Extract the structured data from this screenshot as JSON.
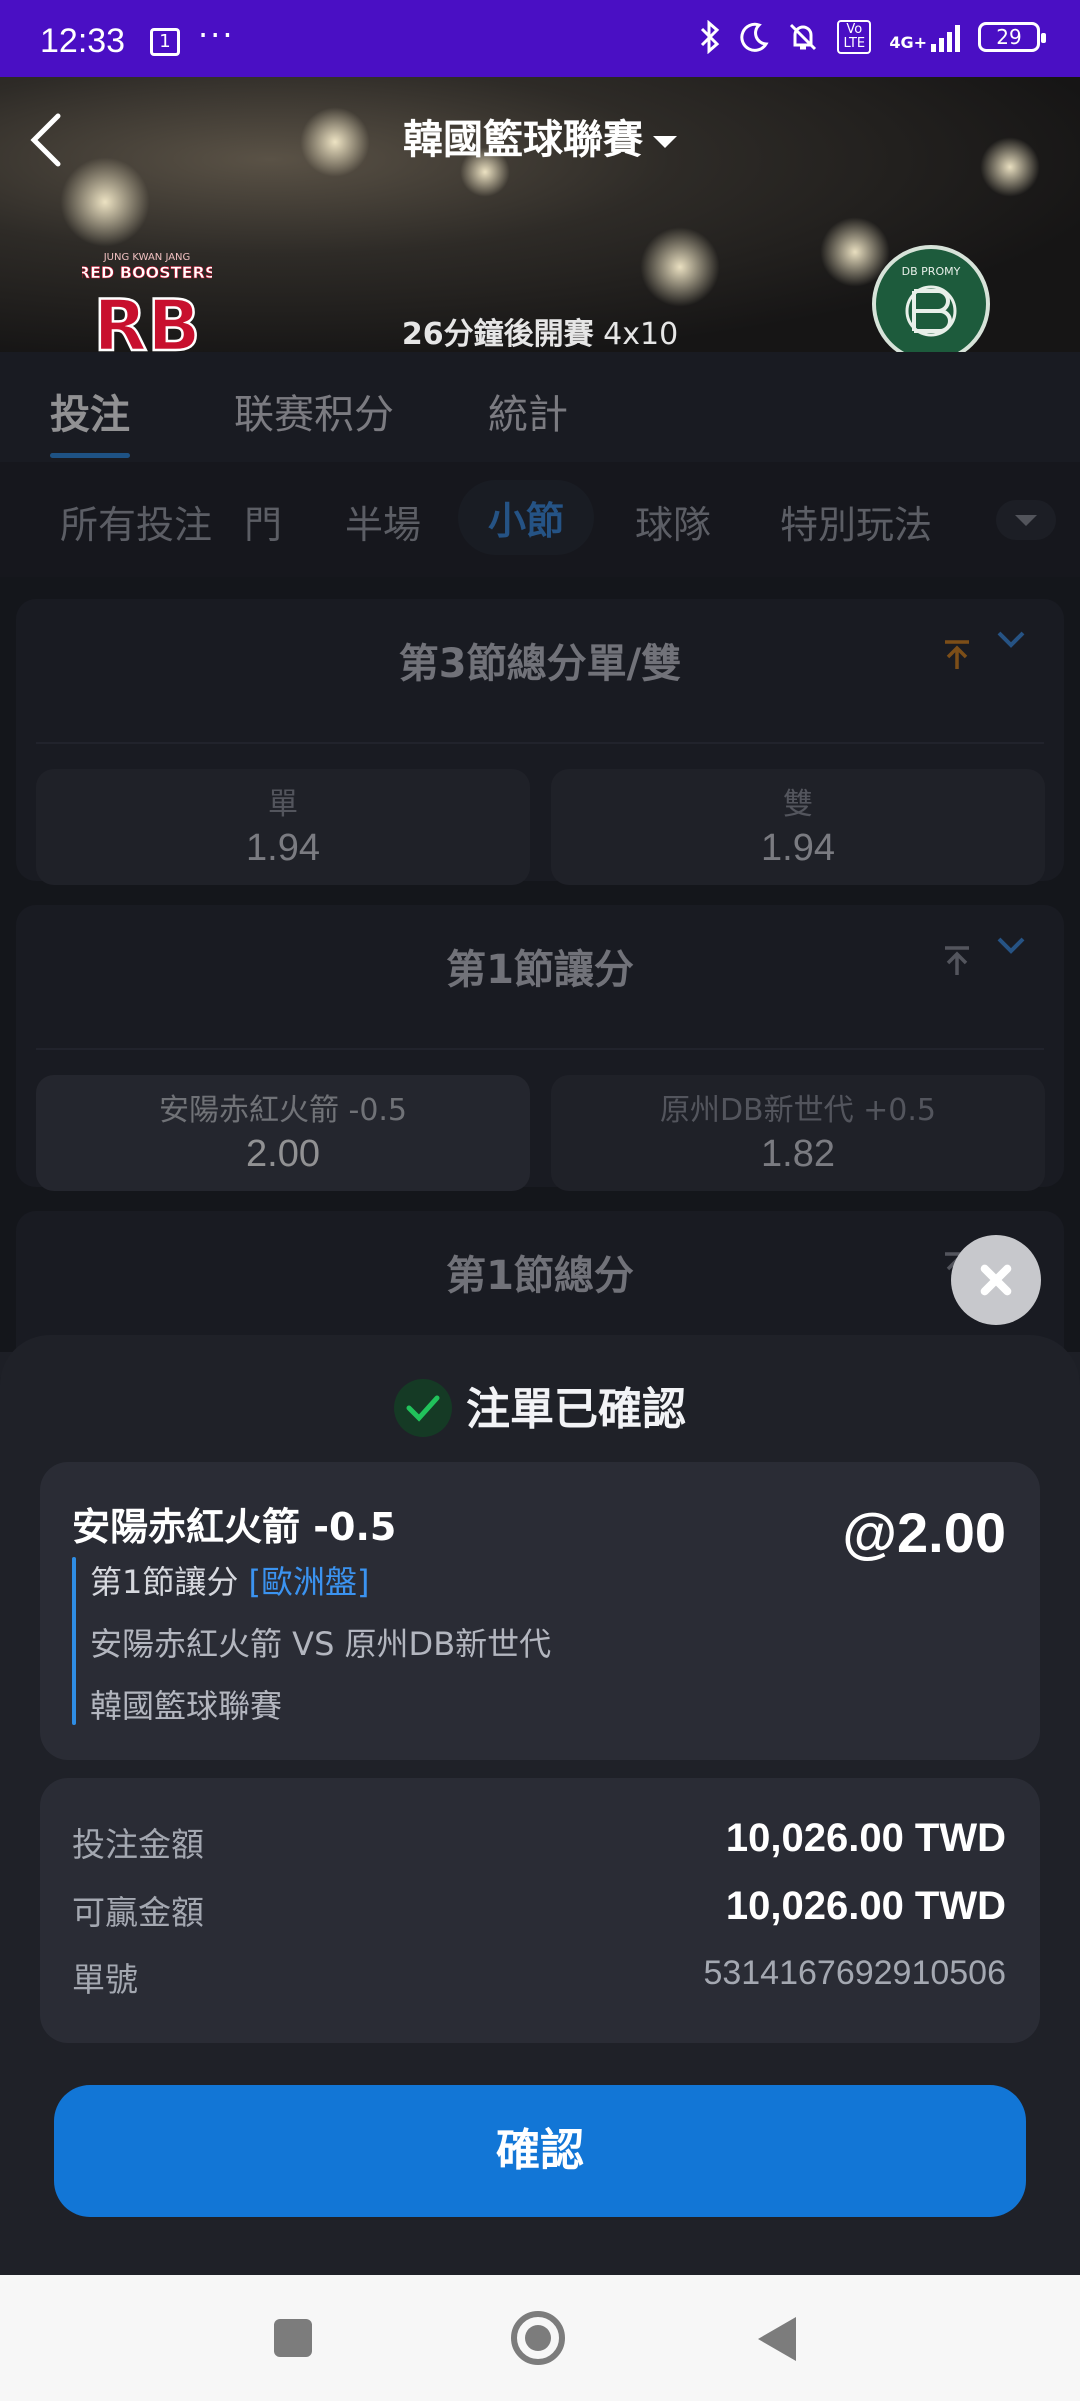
{
  "status_bar": {
    "time": "12:33",
    "sim_badge": "1",
    "more": "···",
    "battery": "29",
    "icons": [
      "bluetooth-icon",
      "moon-icon",
      "mute-bell-icon",
      "volte-icon",
      "4g-signal-icon",
      "battery-icon"
    ],
    "volte": "Vo LTE",
    "net": "4G+"
  },
  "header": {
    "league": "韓國籃球聯賽",
    "kickoff_prefix": "26分鐘後開賽",
    "kickoff_format": "4x10",
    "home_logo_text": "RED BOOSTERS",
    "home_logo_mark": "RB",
    "away_logo_text": "DB PROMY"
  },
  "main_tabs": [
    {
      "label": "投注",
      "active": true
    },
    {
      "label": "联赛积分",
      "active": false
    },
    {
      "label": "統計",
      "active": false
    }
  ],
  "sub_tabs": [
    {
      "label": "所有投注",
      "active": false
    },
    {
      "label": "門",
      "active": false
    },
    {
      "label": "半場",
      "active": false
    },
    {
      "label": "小節",
      "active": true
    },
    {
      "label": "球隊",
      "active": false
    },
    {
      "label": "特別玩法",
      "active": false
    }
  ],
  "markets": [
    {
      "title": "第3節總分單/雙",
      "pin_color": "#d9861f",
      "options": [
        {
          "label": "單",
          "odds": "1.94"
        },
        {
          "label": "雙",
          "odds": "1.94"
        }
      ]
    },
    {
      "title": "第1節讓分",
      "pin_color": "#8f939d",
      "options": [
        {
          "label": "安陽赤紅火箭 -0.5",
          "odds": "2.00",
          "selected": true
        },
        {
          "label": "原州DB新世代 +0.5",
          "odds": "1.82"
        }
      ]
    },
    {
      "title": "第1節總分",
      "pin_color": "#8f939d"
    }
  ],
  "sheet": {
    "title": "注單已確認",
    "selection": "安陽赤紅火箭 -0.5",
    "odds": "@2.00",
    "market": "第1節讓分",
    "odds_type": "[歐洲盤]",
    "fixture": "安陽赤紅火箭 VS 原州DB新世代",
    "league": "韓國籃球聯賽",
    "stake_label": "投注金額",
    "stake_value": "10,026.00 TWD",
    "win_label": "可贏金額",
    "win_value": "10,026.00 TWD",
    "ref_label": "單號",
    "ref_value": "5314167692910506",
    "confirm_button": "確認"
  },
  "colors": {
    "accent": "#2f8de4",
    "button": "#1276d6",
    "status_bar": "#4a0fc4",
    "success": "#21c25b"
  }
}
